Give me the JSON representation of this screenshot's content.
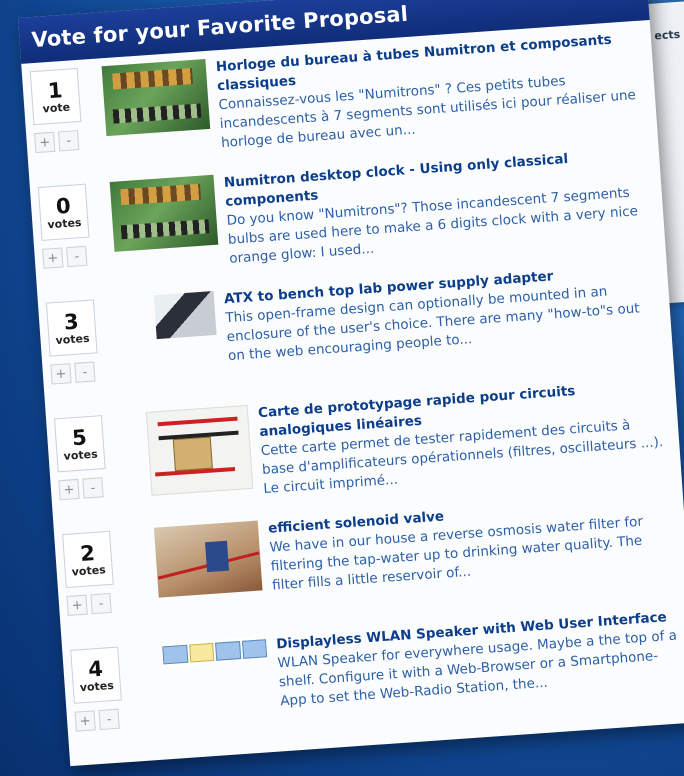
{
  "background": {
    "partial_label": "ects"
  },
  "widget": {
    "title": "Vote for your Favorite Proposal"
  },
  "colors": {
    "header": "#163a8c",
    "title_text": "#0b3d8a",
    "desc_text": "#2c5fa6",
    "page_bg": "#1b5fb3"
  },
  "items": [
    {
      "count": "1",
      "label": "vote",
      "title": "Horloge du bureau à tubes Numitron et composants classiques",
      "desc": "Connaissez-vous les \"Numitrons\" ? Ces petits tubes incandescents à 7 segments sont utilisés ici pour réaliser une horloge de bureau avec un...",
      "thumb": "clock"
    },
    {
      "count": "0",
      "label": "votes",
      "title": "Numitron desktop clock - Using only classical components",
      "desc": "Do you know \"Numitrons\"? Those incandescent 7 segments bulbs are used here to make a 6 digits clock with a very nice orange glow: I used...",
      "thumb": "clock"
    },
    {
      "count": "3",
      "label": "votes",
      "title": "ATX to bench top lab power supply adapter",
      "desc": "This open-frame design can optionally be mounted in an enclosure of the user's choice. There are many \"how-to\"s out on the web encouraging people to...",
      "thumb": "power"
    },
    {
      "count": "5",
      "label": "votes",
      "title": "Carte de prototypage rapide pour circuits analogiques linéaires",
      "desc": "Cette carte permet de tester rapidement des circuits à base d'amplificateurs opérationnels (filtres, oscillateurs ...). Le circuit imprimé...",
      "thumb": "proto"
    },
    {
      "count": "2",
      "label": "votes",
      "title": "efficient solenoid valve",
      "desc": "We have in our house a reverse osmosis water filter for filtering the tap-water up to drinking water quality. The filter fills a little reservoir of...",
      "thumb": "valve"
    },
    {
      "count": "4",
      "label": "votes",
      "title": "Displayless WLAN Speaker with Web User Interface",
      "desc": "WLAN Speaker for everywhere usage. Maybe a the top of a shelf. Configure it with a Web-Browser or a Smartphone-App to set the Web-Radio Station, the...",
      "thumb": "wlan"
    }
  ],
  "buttons": {
    "plus": "+",
    "minus": "-"
  }
}
